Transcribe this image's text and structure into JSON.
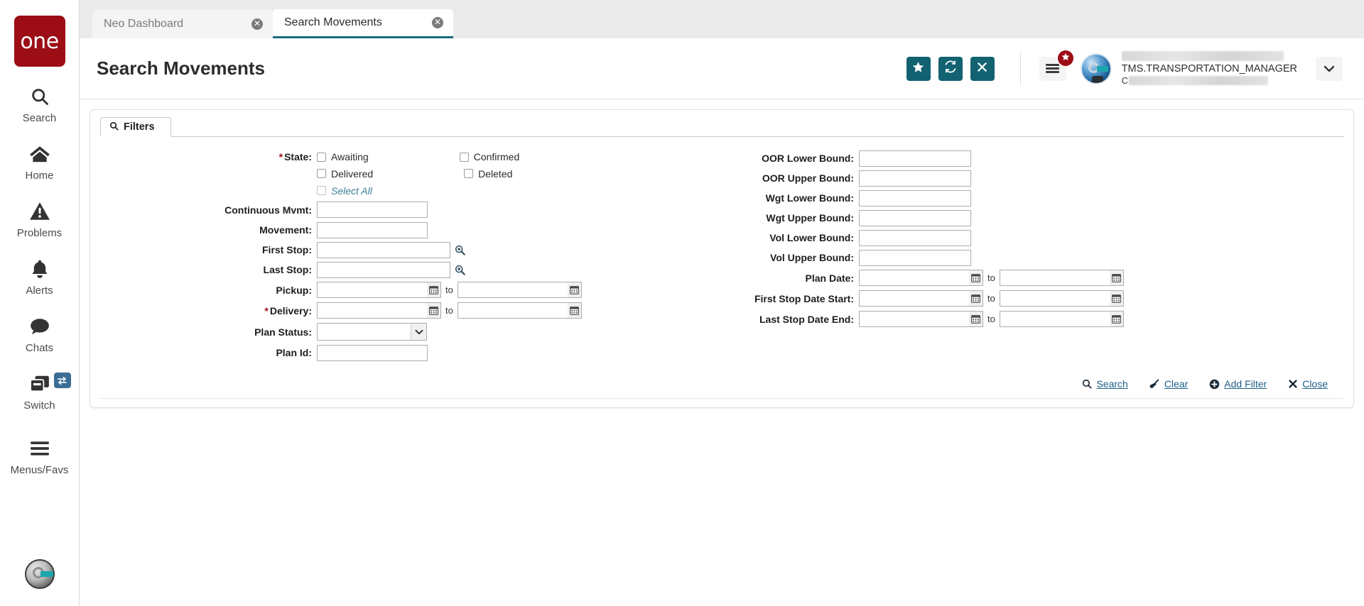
{
  "brand": {
    "logo_text": "one",
    "logo_color": "#9c0d16"
  },
  "sidebar": {
    "items": [
      {
        "label": "Search",
        "icon": "search-icon"
      },
      {
        "label": "Home",
        "icon": "home-icon"
      },
      {
        "label": "Problems",
        "icon": "warning-triangle-icon"
      },
      {
        "label": "Alerts",
        "icon": "bell-icon"
      },
      {
        "label": "Chats",
        "icon": "chat-bubble-icon"
      },
      {
        "label": "Switch",
        "icon": "switch-windows-icon",
        "badge_icon": "swap-arrows-icon"
      },
      {
        "label": "Menus/Favs",
        "icon": "hamburger-icon"
      }
    ],
    "avatar": "user-avatar-icon"
  },
  "tabs": [
    {
      "label": "Neo Dashboard",
      "active": false,
      "closable": true
    },
    {
      "label": "Search Movements",
      "active": true,
      "closable": true
    }
  ],
  "header": {
    "title": "Search Movements",
    "buttons": [
      {
        "name": "favorite-button",
        "icon": "star-icon"
      },
      {
        "name": "refresh-button",
        "icon": "refresh-icon"
      },
      {
        "name": "close-page-button",
        "icon": "close-x-icon"
      }
    ],
    "menu_button": {
      "icon": "hamburger-icon",
      "badge_icon": "star-icon",
      "badge_color": "#9c0d16"
    },
    "user": {
      "name_masked": "",
      "role": "TMS.TRANSPORTATION_MANAGER",
      "org_prefix": "C",
      "org_masked": ""
    },
    "accent_color": "#126272"
  },
  "filters_panel": {
    "tab_label": "Filters",
    "tab_icon": "search-icon",
    "left_column": {
      "state": {
        "label": "State:",
        "required": true,
        "options_col1": [
          {
            "label": "Awaiting",
            "checked": false
          },
          {
            "label": "Delivered",
            "checked": false
          },
          {
            "label": "Select All",
            "checked": false,
            "style": "link"
          }
        ],
        "options_col2": [
          {
            "label": "Confirmed",
            "checked": false
          },
          {
            "label": "Deleted",
            "checked": false
          }
        ]
      },
      "fields": [
        {
          "label": "Continuous Mvmt:",
          "type": "text",
          "value": "",
          "required": false
        },
        {
          "label": "Movement:",
          "type": "text",
          "value": "",
          "required": false
        },
        {
          "label": "First Stop:",
          "type": "lookup",
          "value": "",
          "required": false,
          "icon": "magnifier-plus-icon"
        },
        {
          "label": "Last Stop:",
          "type": "lookup",
          "value": "",
          "required": false,
          "icon": "magnifier-plus-icon"
        },
        {
          "label": "Pickup:",
          "type": "daterange",
          "value_from": "",
          "value_to": "",
          "separator": "to",
          "required": false
        },
        {
          "label": "Delivery:",
          "type": "daterange",
          "value_from": "",
          "value_to": "",
          "separator": "to",
          "required": true
        },
        {
          "label": "Plan Status:",
          "type": "select",
          "value": "",
          "required": false
        },
        {
          "label": "Plan Id:",
          "type": "text",
          "value": "",
          "required": false
        }
      ]
    },
    "right_column": {
      "fields": [
        {
          "label": "OOR Lower Bound:",
          "type": "text",
          "value": ""
        },
        {
          "label": "OOR Upper Bound:",
          "type": "text",
          "value": ""
        },
        {
          "label": "Wgt Lower Bound:",
          "type": "text",
          "value": ""
        },
        {
          "label": "Wgt Upper Bound:",
          "type": "text",
          "value": ""
        },
        {
          "label": "Vol Lower Bound:",
          "type": "text",
          "value": ""
        },
        {
          "label": "Vol Upper Bound:",
          "type": "text",
          "value": ""
        },
        {
          "label": "Plan Date:",
          "type": "daterange",
          "value_from": "",
          "value_to": "",
          "separator": "to"
        },
        {
          "label": "First Stop Date Start:",
          "type": "daterange",
          "value_from": "",
          "value_to": "",
          "separator": "to"
        },
        {
          "label": "Last Stop Date End:",
          "type": "daterange",
          "value_from": "",
          "value_to": "",
          "separator": "to"
        }
      ]
    },
    "actions": [
      {
        "label": "Search",
        "icon": "search-icon"
      },
      {
        "label": "Clear",
        "icon": "broom-icon"
      },
      {
        "label": "Add Filter",
        "icon": "plus-circle-icon"
      },
      {
        "label": "Close",
        "icon": "close-x-icon"
      }
    ],
    "link_color": "#1f5f86"
  }
}
